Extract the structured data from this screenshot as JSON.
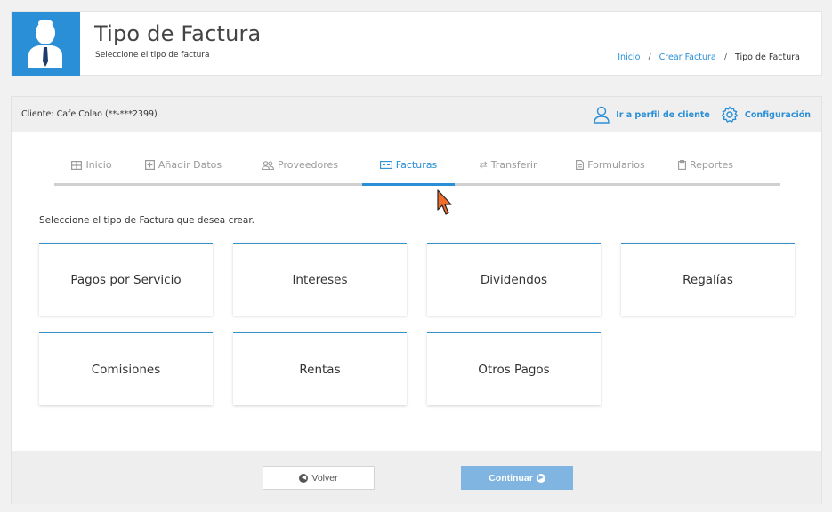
{
  "header": {
    "title": "Tipo de Factura",
    "subtitle": "Seleccione el tipo de factura",
    "breadcrumb": [
      "Inicio",
      "Crear Factura",
      "Tipo de Factura"
    ],
    "breadcrumb_sep": "/"
  },
  "client": {
    "label": "Cliente: Cafe Colao (**-***2399)",
    "profile_link": "Ir a perfil de cliente",
    "config_link": "Configuración"
  },
  "tabs": [
    {
      "label": "Inicio",
      "icon": "grid-icon"
    },
    {
      "label": "Añadir Datos",
      "icon": "plus-square-icon"
    },
    {
      "label": "Proveedores",
      "icon": "users-icon"
    },
    {
      "label": "Facturas",
      "icon": "invoice-icon",
      "active": true
    },
    {
      "label": "Transferir",
      "icon": "transfer-icon"
    },
    {
      "label": "Formularios",
      "icon": "document-icon"
    },
    {
      "label": "Reportes",
      "icon": "clipboard-icon"
    }
  ],
  "instruction": "Seleccione el tipo de Factura que desea crear.",
  "invoice_types": [
    "Pagos por Servicio",
    "Intereses",
    "Dividendos",
    "Regalías",
    "Comisiones",
    "Rentas",
    "Otros Pagos"
  ],
  "footer": {
    "back_label": "Volver",
    "continue_label": "Continuar"
  },
  "colors": {
    "accent": "#2a8fd6",
    "continue_button": "#7fb5e0",
    "cursor": "#f26b2a"
  }
}
